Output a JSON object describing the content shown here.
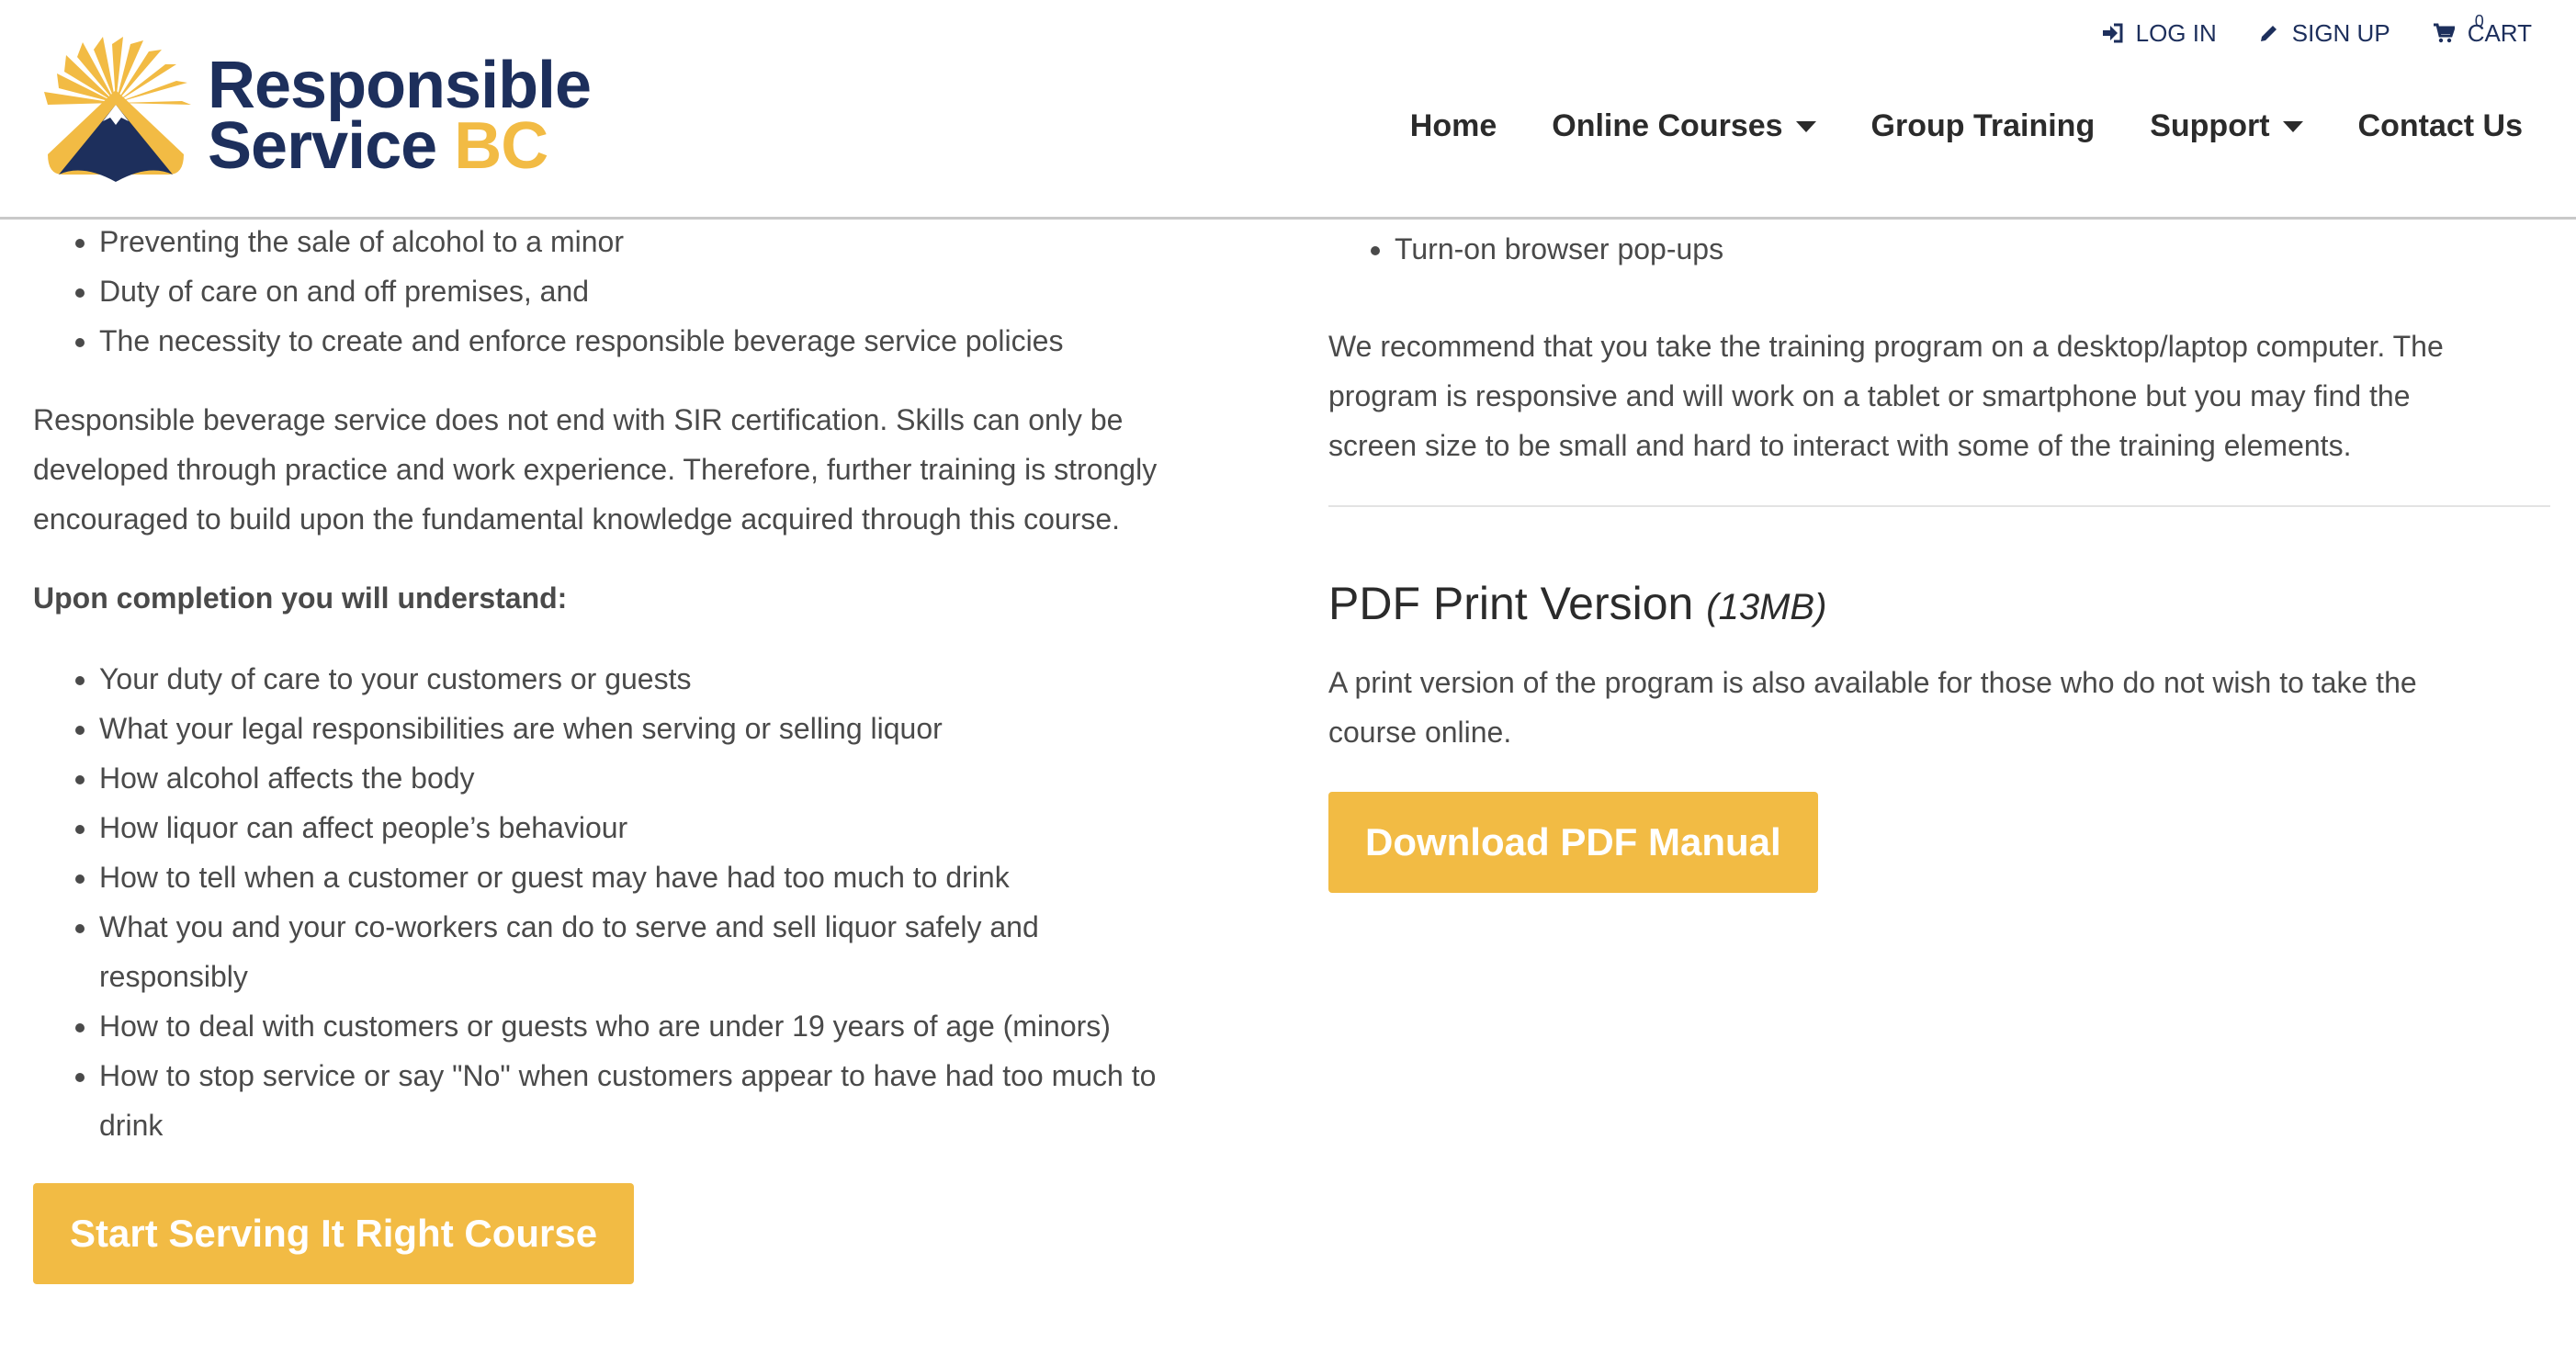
{
  "header": {
    "logo": {
      "line1": "Responsible",
      "line2_main": "Service",
      "line2_accent": "BC"
    },
    "util_nav": {
      "login": "LOG IN",
      "signup": "SIGN UP",
      "cart": "CART",
      "cart_count": "0"
    },
    "main_nav": {
      "home": "Home",
      "online_courses": "Online Courses",
      "group_training": "Group Training",
      "support": "Support",
      "contact": "Contact Us"
    }
  },
  "left": {
    "top_bullets": [
      "Preventing the sale of alcohol to a minor",
      "Duty of care on and off premises, and",
      "The necessity to create and enforce responsible beverage service policies"
    ],
    "paragraph_lines": [
      "Responsible beverage service does not end with SIR certification. Skills can only be",
      "developed through practice and work experience. Therefore, further training is strongly",
      "encouraged to build upon the fundamental knowledge acquired through this course."
    ],
    "understand_heading": "Upon completion you will understand:",
    "understand_bullets": [
      "Your duty of care to your customers or guests",
      "What your legal responsibilities are when serving or selling liquor",
      "How alcohol affects the body",
      "How liquor can affect people’s behaviour",
      "How to tell when a customer or guest may have had too much to drink",
      "What you and your co-workers can do to serve and sell liquor safely and",
      "responsibly",
      "How to deal with customers or guests who are under 19 years of age (minors)",
      "How to stop service or say \"No\" when customers appear to have had too much to",
      "drink"
    ],
    "start_button": "Start Serving It Right Course"
  },
  "right": {
    "popup_bullet": "Turn-on browser pop-ups",
    "recommend_lines": [
      "We recommend that you take the training program on a desktop/laptop computer. The",
      "program is responsive and will work on a tablet or smartphone but you may find the",
      "screen size to be small and hard to interact with some of the training elements."
    ],
    "pdf_title": "PDF Print Version",
    "pdf_size": "(13MB)",
    "pdf_desc_lines": [
      "A print version of the program is also available for those who do not wish to take the",
      "course online."
    ],
    "download_button": "Download PDF Manual"
  },
  "colors": {
    "navy": "#1d2f5c",
    "gold": "#f2bb44",
    "text": "#4a4a4a"
  },
  "icons": [
    "sign-in-icon",
    "pencil-icon",
    "cart-icon",
    "dropdown-caret-icon"
  ]
}
